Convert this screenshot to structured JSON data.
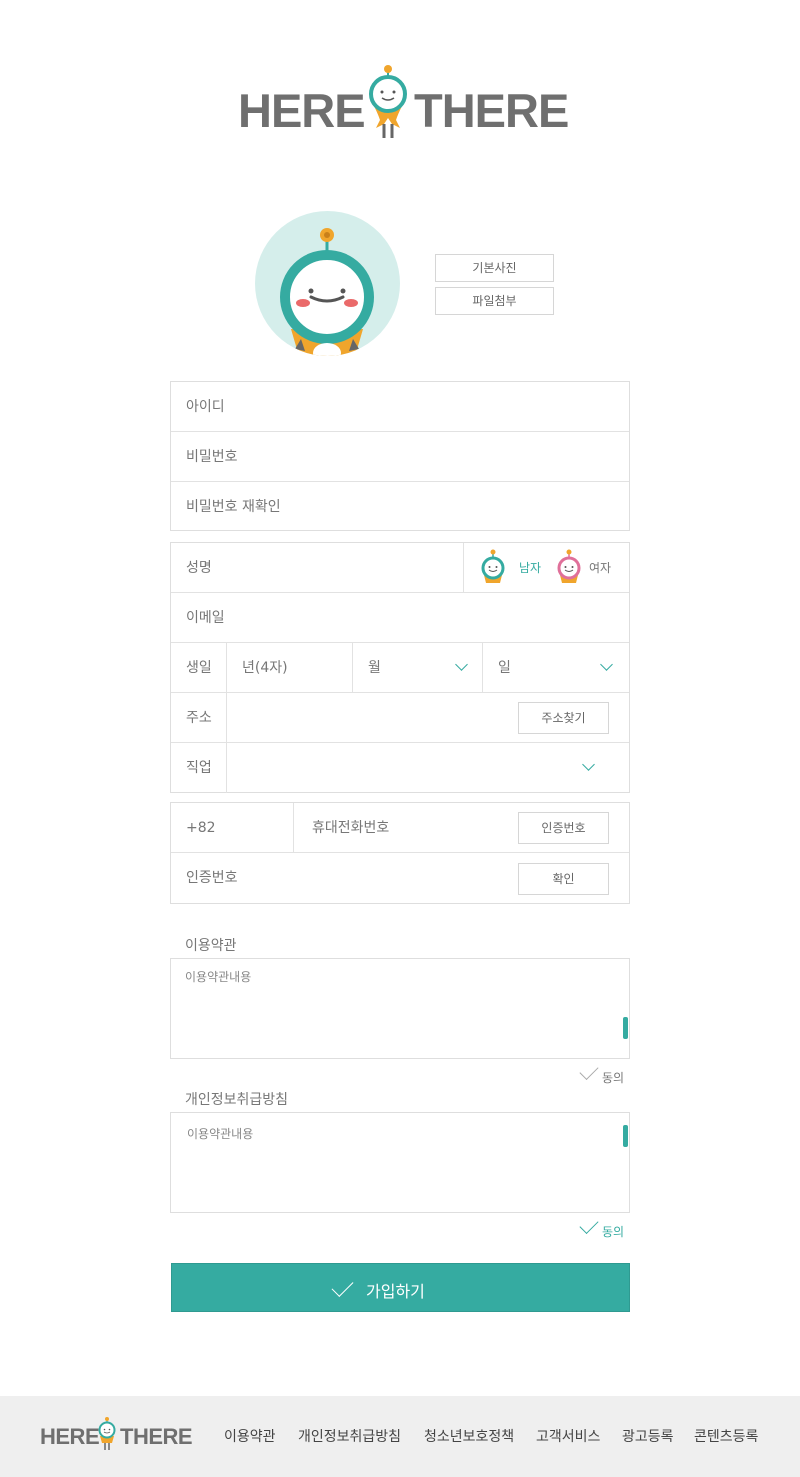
{
  "brand": {
    "left": "HERE",
    "right": "THERE"
  },
  "profile": {
    "default_photo_label": "기본사진",
    "attach_file_label": "파일첨부"
  },
  "account": {
    "id_placeholder": "아이디",
    "password_placeholder": "비밀번호",
    "password_confirm_placeholder": "비밀번호 재확인"
  },
  "personal": {
    "name_placeholder": "성명",
    "gender_male": "남자",
    "gender_female": "여자",
    "selected_gender": "남자",
    "email_placeholder": "이메일",
    "birth_label": "생일",
    "birth_year_placeholder": "년(4자)",
    "birth_month_placeholder": "월",
    "birth_day_placeholder": "일",
    "address_label": "주소",
    "address_search_label": "주소찾기",
    "job_label": "직업"
  },
  "phone": {
    "country_code": "+82",
    "phone_placeholder": "휴대전화번호",
    "request_code_label": "인증번호",
    "code_placeholder": "인증번호",
    "confirm_label": "확인"
  },
  "terms": {
    "title": "이용약관",
    "content": "이용약관내용",
    "agree_label": "동의",
    "agreed": false
  },
  "privacy": {
    "title": "개인정보취급방침",
    "content": "이용약관내용",
    "agree_label": "동의",
    "agreed": true
  },
  "submit_label": "가입하기",
  "footer": {
    "links": [
      "이용약관",
      "개인정보취급방침",
      "청소년보호정책",
      "고객서비스",
      "광고등록",
      "콘텐츠등록"
    ]
  },
  "colors": {
    "accent": "#35aba1",
    "female": "#e0709a",
    "mascot_orange": "#f0a52c"
  }
}
